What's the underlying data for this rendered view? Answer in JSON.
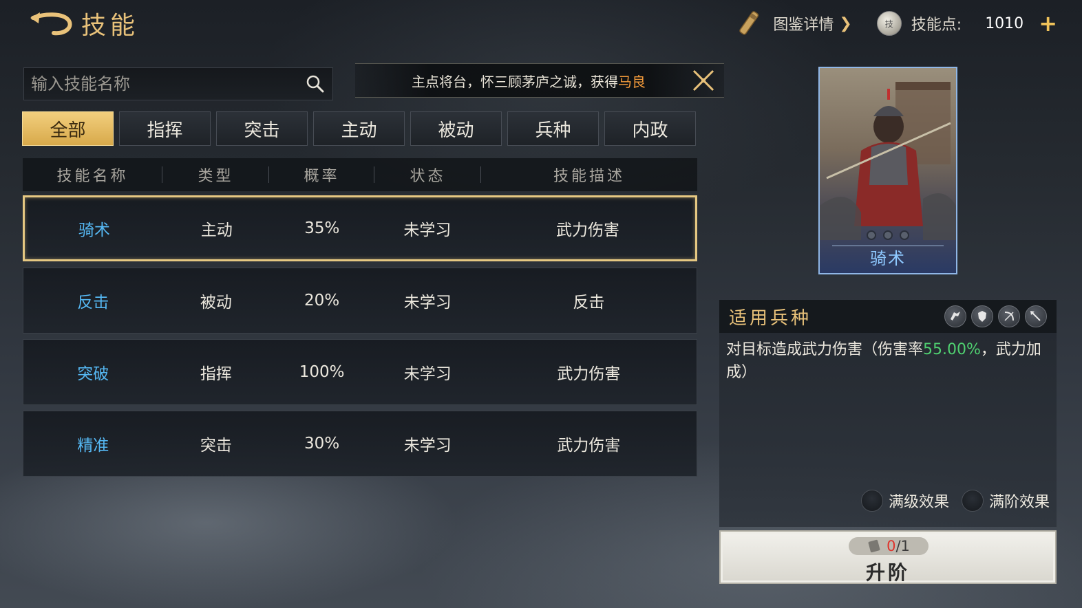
{
  "header": {
    "title": "技能",
    "codex_label": "图鉴详情",
    "skill_points_label": "技能点:",
    "skill_points_value": "1010"
  },
  "search": {
    "placeholder": "输入技能名称"
  },
  "notice": {
    "text_before": "主点将台，怀三顾茅庐之诚，获得",
    "highlight": "马良"
  },
  "tabs": [
    "全部",
    "指挥",
    "突击",
    "主动",
    "被动",
    "兵种",
    "内政"
  ],
  "table": {
    "headers": [
      "技能名称",
      "类型",
      "概率",
      "状态",
      "技能描述"
    ],
    "rows": [
      {
        "name": "骑术",
        "type": "主动",
        "rate": "35%",
        "status": "未学习",
        "desc": "武力伤害"
      },
      {
        "name": "反击",
        "type": "被动",
        "rate": "20%",
        "status": "未学习",
        "desc": "反击"
      },
      {
        "name": "突破",
        "type": "指挥",
        "rate": "100%",
        "status": "未学习",
        "desc": "武力伤害"
      },
      {
        "name": "精准",
        "type": "突击",
        "rate": "30%",
        "status": "未学习",
        "desc": "武力伤害"
      }
    ]
  },
  "card": {
    "name": "骑术"
  },
  "detail": {
    "title": "适用兵种",
    "troop_icons": [
      "cavalry-icon",
      "shield-icon",
      "bow-icon",
      "spear-icon"
    ],
    "desc_before": "对目标造成武力伤害（伤害率",
    "desc_value": "55.00%",
    "desc_after": "，武力加成）",
    "max_level_label": "满级效果",
    "max_rank_label": "满阶效果"
  },
  "upgrade": {
    "cost_have": "0",
    "cost_need": "/1",
    "label": "升阶"
  },
  "colors": {
    "accent_gold": "#e9c27a",
    "skill_name_blue": "#55b7f2",
    "highlight_orange": "#f29a3b",
    "value_green": "#4fd070",
    "cost_red": "#e0342c"
  }
}
